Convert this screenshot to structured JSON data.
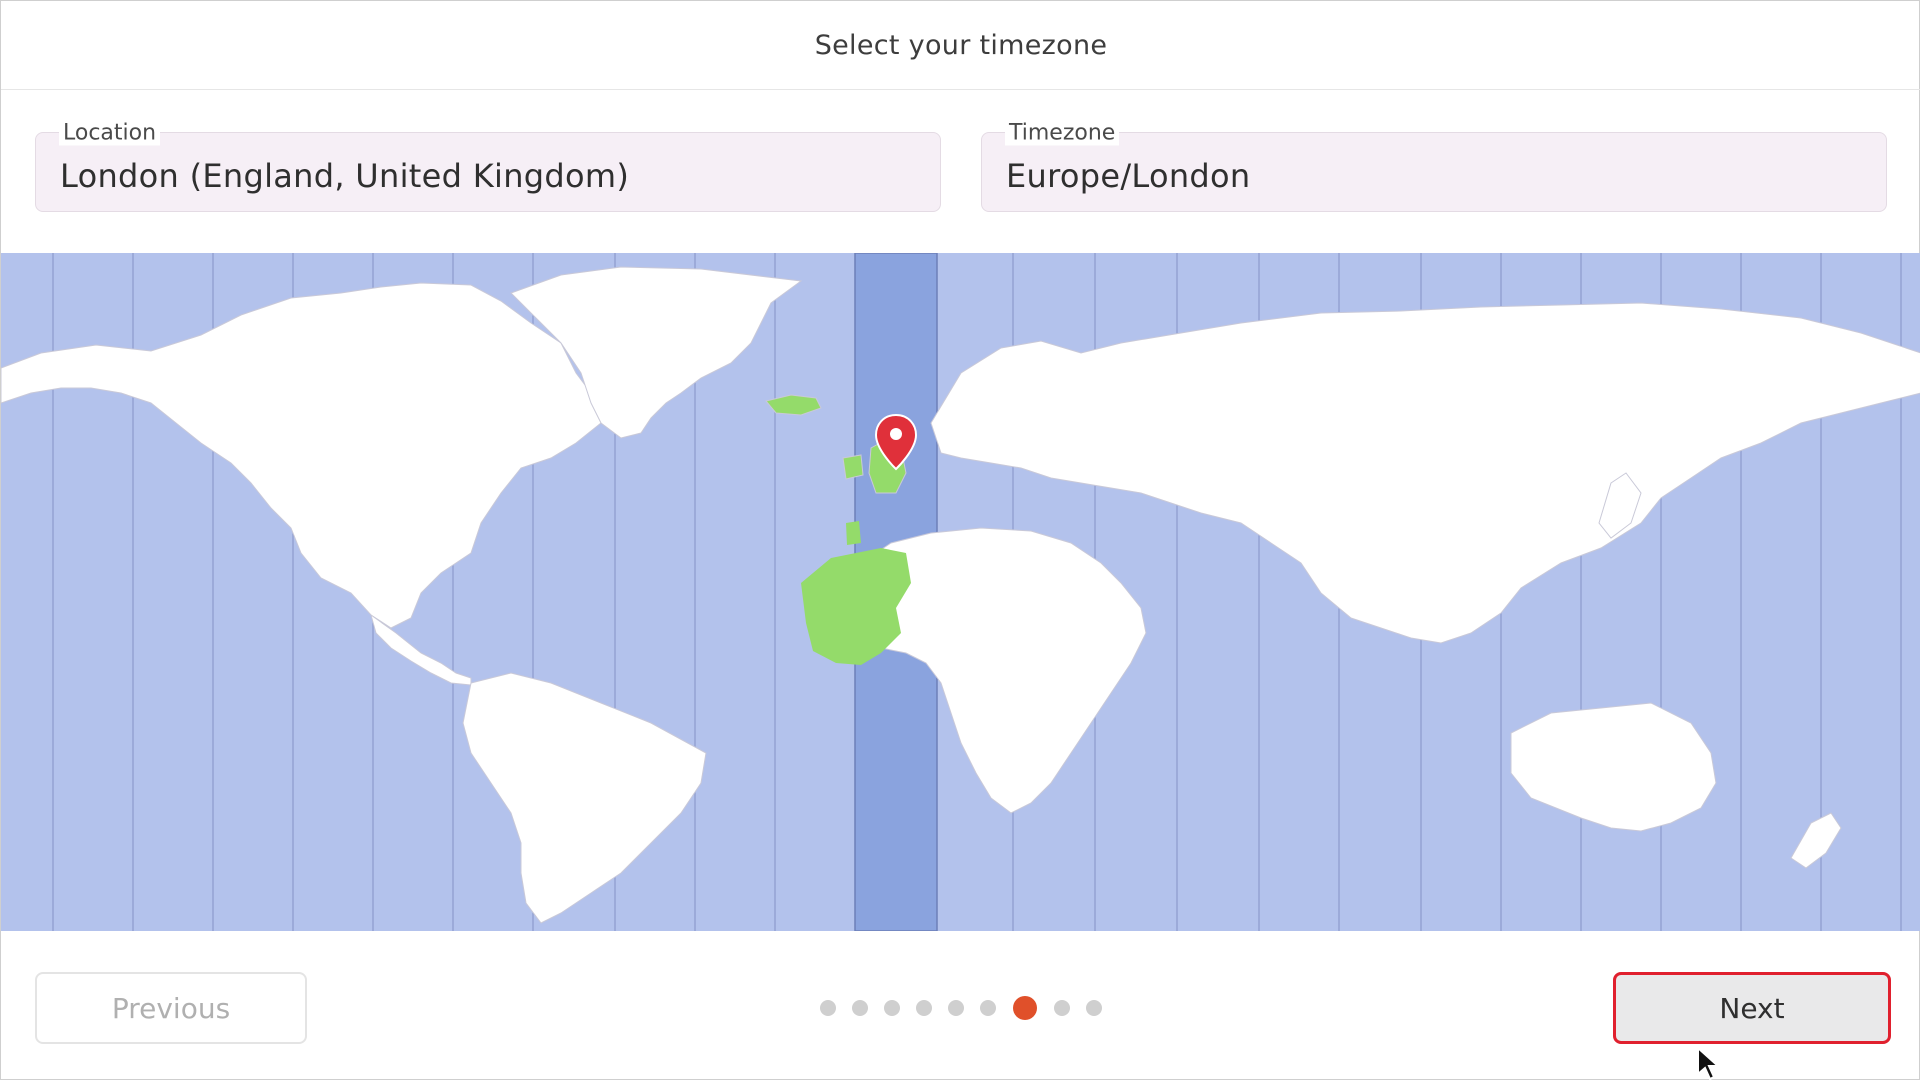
{
  "header": {
    "title": "Select your timezone"
  },
  "location": {
    "label": "Location",
    "value": "London (England, United Kingdom)"
  },
  "timezone": {
    "label": "Timezone",
    "value": "Europe/London"
  },
  "map": {
    "ocean_color": "#b3c2ec",
    "selected_zone_color": "#8aa3de",
    "land_color": "#ffffff",
    "highlight_land_color": "#94db6a",
    "marker_color": "#e0303a",
    "marker_icon": "map-pin-icon"
  },
  "footer": {
    "previous_label": "Previous",
    "next_label": "Next",
    "steps_total": 9,
    "steps_current": 7,
    "active_dot_color": "#e0502a",
    "next_highlight_color": "#e0202e"
  }
}
